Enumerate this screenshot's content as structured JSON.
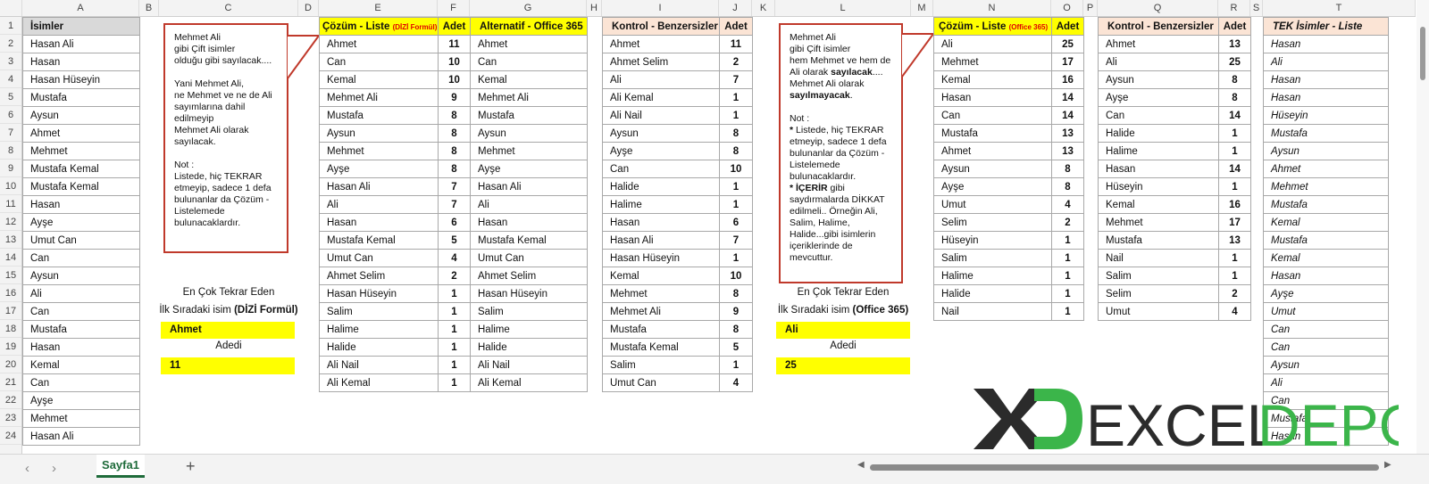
{
  "sheet": {
    "column_headers": [
      "A",
      "B",
      "C",
      "D",
      "E",
      "F",
      "G",
      "H",
      "I",
      "J",
      "K",
      "L",
      "M",
      "N",
      "O",
      "P",
      "Q",
      "R",
      "S",
      "T"
    ],
    "row_numbers": [
      "1",
      "2",
      "3",
      "4",
      "5",
      "6",
      "7",
      "8",
      "9",
      "10",
      "11",
      "12",
      "13",
      "14",
      "15",
      "16",
      "17",
      "18",
      "19",
      "20",
      "21",
      "22",
      "23",
      "24"
    ]
  },
  "list_a": {
    "header": "İsimler",
    "rows": [
      "Hasan Ali",
      "Hasan",
      "Hasan Hüseyin",
      "Mustafa",
      "Aysun",
      "Ahmet",
      "Mehmet",
      "Mustafa Kemal",
      "Mustafa Kemal",
      "Hasan",
      "Ayşe",
      "Umut Can",
      "Can",
      "Aysun",
      "Ali",
      "Can",
      "Mustafa",
      "Hasan",
      "Kemal",
      "Can",
      "Ayşe",
      "Mehmet",
      "Hasan Ali"
    ]
  },
  "callout_left": "Mehmet Ali\ngibi Çift isimler\nolduğu gibi sayılacak....\n\nYani Mehmet Ali,\nne Mehmet ve ne de Ali\nsayımlarına dahil\nedilmeyip\nMehmet Ali olarak\nsayılacak.\n\nNot :\nListede, hiç TEKRAR\netmeyip, sadece 1 defa\nbulunanlar da Çözüm -\nListelemede\nbulunacaklardır.",
  "left_summary": {
    "line1": "En Çok Tekrar Eden",
    "line2_prefix": "İlk Sıradaki isim ",
    "line2_bold": "(DİZİ Formül)",
    "name": "Ahmet",
    "count_label": "Adedi",
    "count": "11"
  },
  "solution_a": {
    "title": "Çözüm - Liste",
    "title_note": "(DİZİ Formül)",
    "count_header": "Adet",
    "alt_header": "Alternatif - Office 365",
    "rows": [
      {
        "name": "Ahmet",
        "count": "11"
      },
      {
        "name": "Can",
        "count": "10"
      },
      {
        "name": "Kemal",
        "count": "10"
      },
      {
        "name": "Mehmet Ali",
        "count": "9"
      },
      {
        "name": "Mustafa",
        "count": "8"
      },
      {
        "name": "Aysun",
        "count": "8"
      },
      {
        "name": "Mehmet",
        "count": "8"
      },
      {
        "name": "Ayşe",
        "count": "8"
      },
      {
        "name": "Hasan Ali",
        "count": "7"
      },
      {
        "name": "Ali",
        "count": "7"
      },
      {
        "name": "Hasan",
        "count": "6"
      },
      {
        "name": "Mustafa Kemal",
        "count": "5"
      },
      {
        "name": "Umut Can",
        "count": "4"
      },
      {
        "name": "Ahmet Selim",
        "count": "2"
      },
      {
        "name": "Hasan Hüseyin",
        "count": "1"
      },
      {
        "name": "Salim",
        "count": "1"
      },
      {
        "name": "Halime",
        "count": "1"
      },
      {
        "name": "Halide",
        "count": "1"
      },
      {
        "name": "Ali Nail",
        "count": "1"
      },
      {
        "name": "Ali Kemal",
        "count": "1"
      }
    ]
  },
  "control_a": {
    "title": "Kontrol - Benzersizler",
    "count_header": "Adet",
    "rows": [
      {
        "name": "Ahmet",
        "count": "11"
      },
      {
        "name": "Ahmet Selim",
        "count": "2"
      },
      {
        "name": "Ali",
        "count": "7"
      },
      {
        "name": "Ali Kemal",
        "count": "1"
      },
      {
        "name": "Ali Nail",
        "count": "1"
      },
      {
        "name": "Aysun",
        "count": "8"
      },
      {
        "name": "Ayşe",
        "count": "8"
      },
      {
        "name": "Can",
        "count": "10"
      },
      {
        "name": "Halide",
        "count": "1"
      },
      {
        "name": "Halime",
        "count": "1"
      },
      {
        "name": "Hasan",
        "count": "6"
      },
      {
        "name": "Hasan Ali",
        "count": "7"
      },
      {
        "name": "Hasan Hüseyin",
        "count": "1"
      },
      {
        "name": "Kemal",
        "count": "10"
      },
      {
        "name": "Mehmet",
        "count": "8"
      },
      {
        "name": "Mehmet Ali",
        "count": "9"
      },
      {
        "name": "Mustafa",
        "count": "8"
      },
      {
        "name": "Mustafa Kemal",
        "count": "5"
      },
      {
        "name": "Salim",
        "count": "1"
      },
      {
        "name": "Umut Can",
        "count": "4"
      }
    ]
  },
  "callout_right": {
    "l1": "Mehmet Ali",
    "l2": "gibi Çift isimler",
    "l3": "hem Mehmet ve hem de",
    "l4a": "Ali olarak ",
    "l4b": "sayılacak",
    "l4c": "....",
    "l5": "Mehmet Ali olarak",
    "l6": "sayılmayacak",
    "l6c": ".",
    "note": "Not :",
    "b1a": "* ",
    "b1b": "Listede, hiç TEKRAR\netmeyip, sadece 1 defa\nbulunanlar da Çözüm -\nListelemede\nbulunacaklardır.",
    "b2a": "* ",
    "b2b": "İÇERİR",
    "b2c": " gibi\nsaydırmalarda DİKKAT\nedilmeli.. Örneğin Ali,\nSalim, Halime,\nHalide...gibi isimlerin\niçeriklerinde de\nmevcuttur."
  },
  "right_summary": {
    "line1": "En Çok Tekrar Eden",
    "line2_prefix": "İlk Sıradaki isim ",
    "line2_bold": "(Office 365)",
    "name": "Ali",
    "count_label": "Adedi",
    "count": "25"
  },
  "solution_b": {
    "title": "Çözüm - Liste",
    "title_note": "(Office 365)",
    "count_header": "Adet",
    "rows": [
      {
        "name": "Ali",
        "count": "25"
      },
      {
        "name": "Mehmet",
        "count": "17"
      },
      {
        "name": "Kemal",
        "count": "16"
      },
      {
        "name": "Hasan",
        "count": "14"
      },
      {
        "name": "Can",
        "count": "14"
      },
      {
        "name": "Mustafa",
        "count": "13"
      },
      {
        "name": "Ahmet",
        "count": "13"
      },
      {
        "name": "Aysun",
        "count": "8"
      },
      {
        "name": "Ayşe",
        "count": "8"
      },
      {
        "name": "Umut",
        "count": "4"
      },
      {
        "name": "Selim",
        "count": "2"
      },
      {
        "name": "Hüseyin",
        "count": "1"
      },
      {
        "name": "Salim",
        "count": "1"
      },
      {
        "name": "Halime",
        "count": "1"
      },
      {
        "name": "Halide",
        "count": "1"
      },
      {
        "name": "Nail",
        "count": "1"
      }
    ]
  },
  "control_b": {
    "title": "Kontrol - Benzersizler",
    "count_header": "Adet",
    "rows": [
      {
        "name": "Ahmet",
        "count": "13"
      },
      {
        "name": "Ali",
        "count": "25"
      },
      {
        "name": "Aysun",
        "count": "8"
      },
      {
        "name": "Ayşe",
        "count": "8"
      },
      {
        "name": "Can",
        "count": "14"
      },
      {
        "name": "Halide",
        "count": "1"
      },
      {
        "name": "Halime",
        "count": "1"
      },
      {
        "name": "Hasan",
        "count": "14"
      },
      {
        "name": "Hüseyin",
        "count": "1"
      },
      {
        "name": "Kemal",
        "count": "16"
      },
      {
        "name": "Mehmet",
        "count": "17"
      },
      {
        "name": "Mustafa",
        "count": "13"
      },
      {
        "name": "Nail",
        "count": "1"
      },
      {
        "name": "Salim",
        "count": "1"
      },
      {
        "name": "Selim",
        "count": "2"
      },
      {
        "name": "Umut",
        "count": "4"
      }
    ]
  },
  "unique_list": {
    "header": "TEK İsimler - Liste",
    "rows": [
      "Hasan",
      "Ali",
      "Hasan",
      "Hasan",
      "Hüseyin",
      "Mustafa",
      "Aysun",
      "Ahmet",
      "Mehmet",
      "Mustafa",
      "Kemal",
      "Mustafa",
      "Kemal",
      "Hasan",
      "Ayşe",
      "Umut",
      "Can",
      "Can",
      "Aysun",
      "Ali",
      "Can",
      "Mustafa",
      "Hasan"
    ]
  },
  "tabs": {
    "nav_prev": "‹",
    "nav_next": "›",
    "active_sheet": "Sayfa1",
    "add_sheet": "+"
  },
  "logo": {
    "text_a": "EXCEL",
    "text_b": "DEPO"
  },
  "colors": {
    "accent_yellow": "#ffff00",
    "header_peach": "#fbe4d5",
    "callout_red": "#c0392b",
    "logo_green": "#3bb54a",
    "logo_dark": "#2b2b2b"
  }
}
